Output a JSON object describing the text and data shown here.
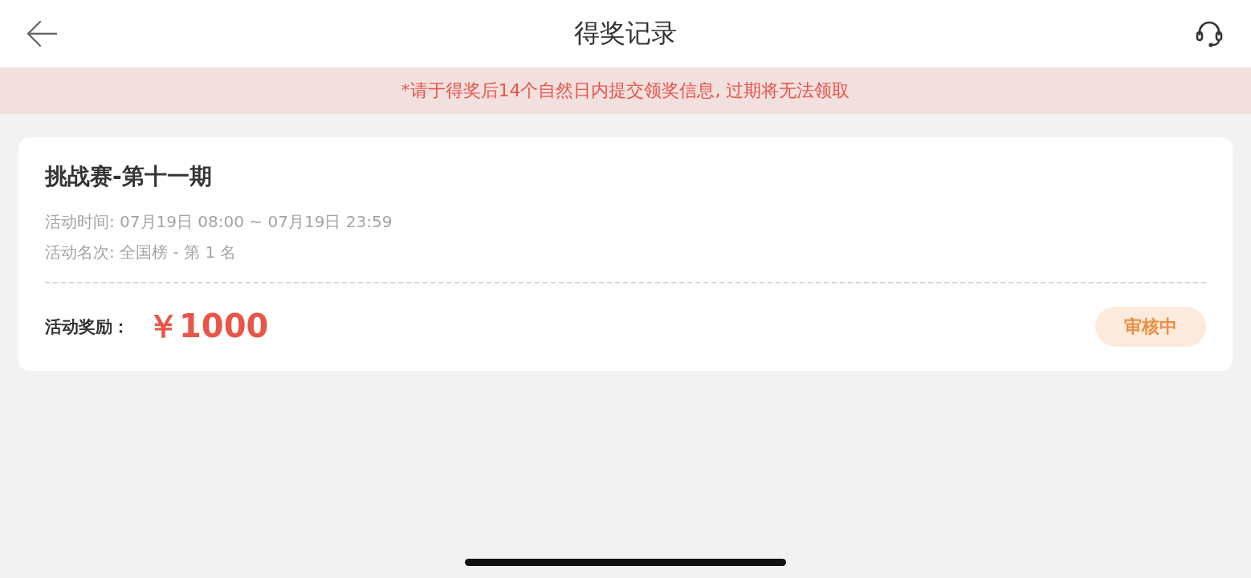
{
  "header": {
    "title": "得奖记录"
  },
  "notice": "*请于得奖后14个自然日内提交领奖信息, 过期将无法领取",
  "records": [
    {
      "title": "挑战赛-第十一期",
      "time": "活动时间: 07月19日 08:00 ~ 07月19日 23:59",
      "rank": "活动名次: 全国榜 - 第 1 名",
      "reward_label": "活动奖励：",
      "reward_amount": "￥1000",
      "status": {
        "label": "审核中",
        "kind": "pending"
      }
    }
  ]
}
